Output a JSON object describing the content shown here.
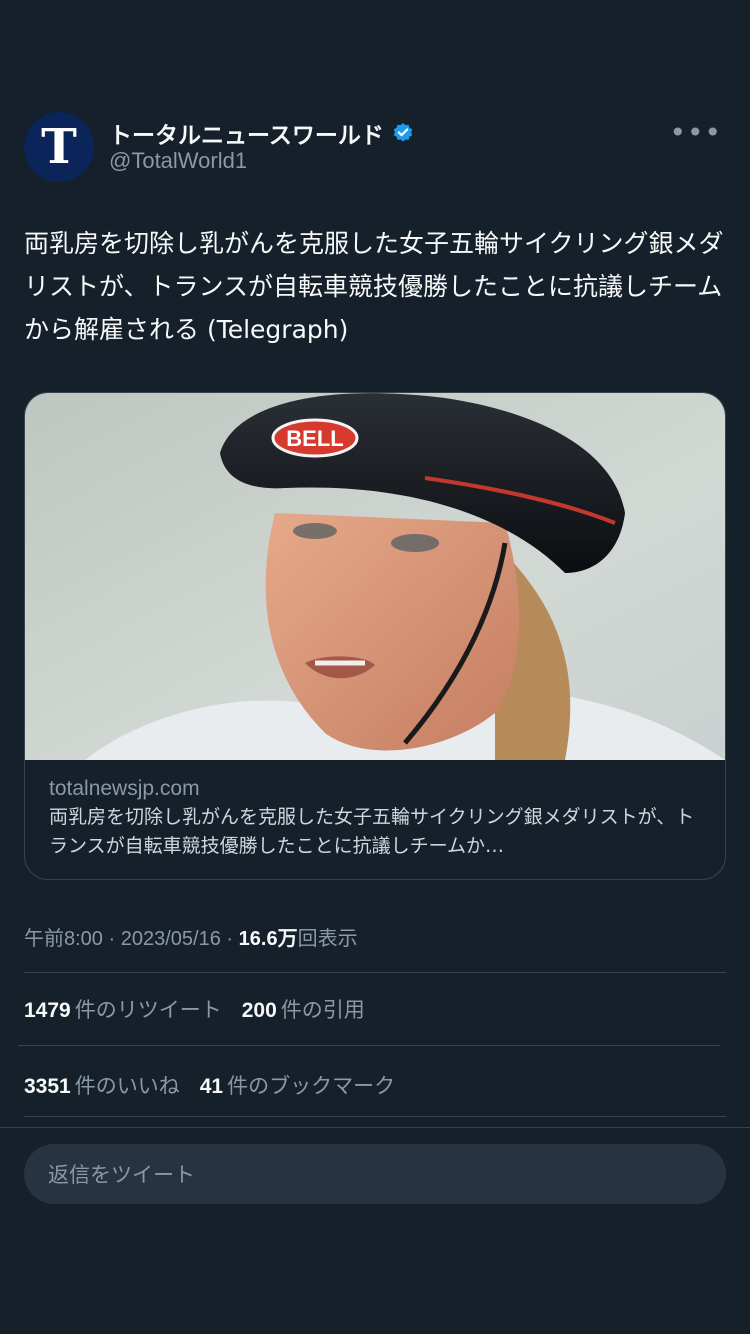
{
  "tweet": {
    "avatar_letter": "T",
    "display_name": "トータルニュースワールド",
    "handle": "@TotalWorld1",
    "more_label": "•••",
    "text": "両乳房を切除し乳がんを克服した女子五輪サイクリング銀メダリストが、トランスが自転車競技優勝したことに抗議しチームから解雇される (Telegraph)",
    "card": {
      "image_text": "BELL",
      "domain": "totalnewsjp.com",
      "title": "両乳房を切除し乳がんを克服した女子五輪サイクリング銀メダリストが、トランスが自転車競技優勝したことに抗議しチームか…"
    },
    "time": "午前8:00",
    "date": "2023/05/16",
    "views_count": "16.6万",
    "views_label": "回表示",
    "retweets_count": "1479",
    "retweets_label": "件のリツイート",
    "quotes_count": "200",
    "quotes_label": "件の引用",
    "likes_count": "3351",
    "likes_label": "件のいいね",
    "bookmarks_count": "41",
    "bookmarks_label": "件のブックマーク",
    "sep": "·"
  },
  "reply": {
    "placeholder": "返信をツイート"
  },
  "colors": {
    "background": "#15202b",
    "text": "#f7f9f9",
    "muted": "#8b98a5",
    "border": "#38444d",
    "verified": "#1d9bf0",
    "avatar_bg": "#0b2459"
  }
}
